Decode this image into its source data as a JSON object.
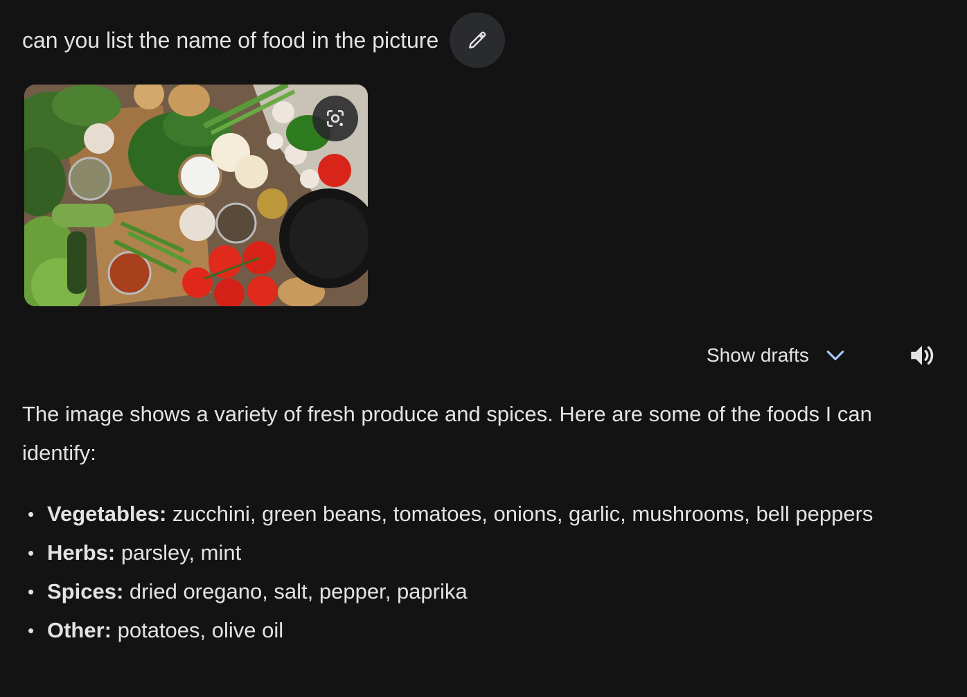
{
  "prompt": {
    "text": "can you list the name of food in the picture",
    "edit_icon": "pencil-icon"
  },
  "image": {
    "lens_icon": "google-lens-icon"
  },
  "drafts": {
    "label": "Show drafts",
    "chevron_icon": "chevron-down-icon",
    "chevron_color": "#a8c7fa"
  },
  "speaker": {
    "icon": "speaker-icon"
  },
  "response": {
    "intro": "The image shows a variety of fresh produce and spices. Here are some of the foods I can identify:",
    "items": [
      {
        "label": "Vegetables:",
        "text": " zucchini, green beans, tomatoes, onions, garlic, mushrooms, bell peppers"
      },
      {
        "label": "Herbs:",
        "text": " parsley, mint"
      },
      {
        "label": "Spices:",
        "text": " dried oregano, salt, pepper, paprika"
      },
      {
        "label": "Other:",
        "text": " potatoes, olive oil"
      }
    ],
    "bullet": "•"
  },
  "colors": {
    "background": "#131314",
    "text": "#e3e3e3",
    "button_bg": "#2a2b2e",
    "accent": "#a8c7fa"
  }
}
